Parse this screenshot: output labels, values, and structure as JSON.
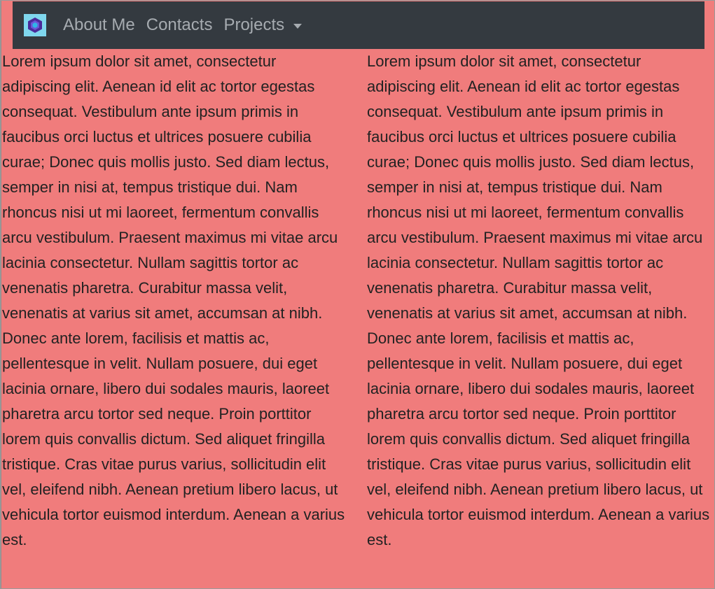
{
  "navbar": {
    "brand_icon": "cube-logo-icon",
    "links": {
      "about": "About Me",
      "contacts": "Contacts",
      "projects": "Projects"
    }
  },
  "columns": {
    "left_text": "Lorem ipsum dolor sit amet, consectetur adipiscing elit. Aenean id elit ac tortor egestas consequat. Vestibulum ante ipsum primis in faucibus orci luctus et ultrices posuere cubilia curae; Donec quis mollis justo. Sed diam lectus, semper in nisi at, tempus tristique dui. Nam rhoncus nisi ut mi laoreet, fermentum convallis arcu vestibulum. Praesent maximus mi vitae arcu lacinia consectetur. Nullam sagittis tortor ac venenatis pharetra. Curabitur massa velit, venenatis at varius sit amet, accumsan at nibh. Donec ante lorem, facilisis et mattis ac, pellentesque in velit. Nullam posuere, dui eget lacinia ornare, libero dui sodales mauris, laoreet pharetra arcu tortor sed neque. Proin porttitor lorem quis convallis dictum. Sed aliquet fringilla tristique. Cras vitae purus varius, sollicitudin elit vel, eleifend nibh. Aenean pretium libero lacus, ut vehicula tortor euismod interdum. Aenean a varius est.",
    "right_text": "Lorem ipsum dolor sit amet, consectetur adipiscing elit. Aenean id elit ac tortor egestas consequat. Vestibulum ante ipsum primis in faucibus orci luctus et ultrices posuere cubilia curae; Donec quis mollis justo. Sed diam lectus, semper in nisi at, tempus tristique dui. Nam rhoncus nisi ut mi laoreet, fermentum convallis arcu vestibulum. Praesent maximus mi vitae arcu lacinia consectetur. Nullam sagittis tortor ac venenatis pharetra. Curabitur massa velit, venenatis at varius sit amet, accumsan at nibh. Donec ante lorem, facilisis et mattis ac, pellentesque in velit. Nullam posuere, dui eget lacinia ornare, libero dui sodales mauris, laoreet pharetra arcu tortor sed neque. Proin porttitor lorem quis convallis dictum. Sed aliquet fringilla tristique. Cras vitae purus varius, sollicitudin elit vel, eleifend nibh. Aenean pretium libero lacus, ut vehicula tortor euismod interdum. Aenean a varius est."
  },
  "colors": {
    "page_background": "#f07c7c",
    "navbar_background": "#343a40",
    "nav_link": "#a6abb0",
    "brand_background": "#7fd7ee",
    "body_text": "#222222"
  }
}
